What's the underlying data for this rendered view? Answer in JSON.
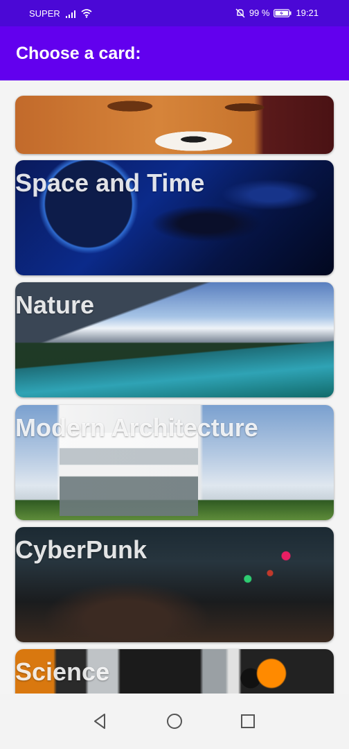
{
  "status_bar": {
    "carrier": "SUPER",
    "battery": "99 %",
    "time": "19:21"
  },
  "app_bar": {
    "title": "Choose a card:"
  },
  "cards": [
    {
      "label": ""
    },
    {
      "label": "Space and Time"
    },
    {
      "label": "Nature"
    },
    {
      "label": "Modern Architecture"
    },
    {
      "label": "CyberPunk"
    },
    {
      "label": "Science"
    }
  ],
  "colors": {
    "status_bar": "#4b08d6",
    "app_bar": "#6200ee",
    "background": "#f4f4f4"
  },
  "icons": [
    "signal-icon",
    "wifi-icon",
    "mute-icon",
    "battery-icon",
    "back-icon",
    "home-icon",
    "recents-icon"
  ]
}
